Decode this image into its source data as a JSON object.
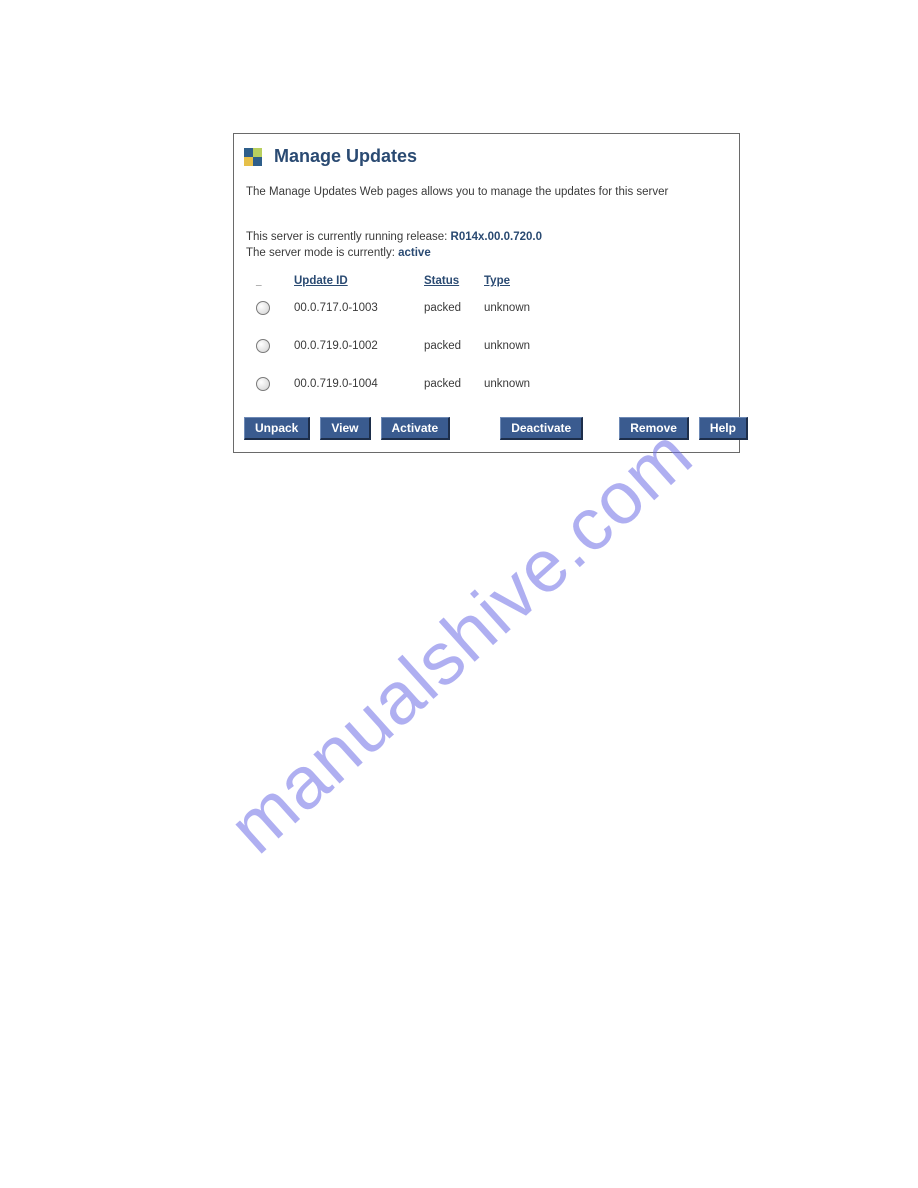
{
  "title": "Manage Updates",
  "description": "The Manage Updates Web pages allows you to manage the updates for this server",
  "release_label": "This server is currently running release: ",
  "release_value": "R014x.00.0.720.0",
  "mode_label": "The server mode is currently: ",
  "mode_value": "active",
  "headers": {
    "placeholder": "_",
    "update_id": "Update ID",
    "status": "Status",
    "type": "Type"
  },
  "rows": [
    {
      "update_id": "00.0.717.0-1003",
      "status": "packed",
      "type": "unknown"
    },
    {
      "update_id": "00.0.719.0-1002",
      "status": "packed",
      "type": "unknown"
    },
    {
      "update_id": "00.0.719.0-1004",
      "status": "packed",
      "type": "unknown"
    }
  ],
  "buttons": {
    "unpack": "Unpack",
    "view": "View",
    "activate": "Activate",
    "deactivate": "Deactivate",
    "remove": "Remove",
    "help": "Help"
  },
  "watermark": "manualshive.com"
}
